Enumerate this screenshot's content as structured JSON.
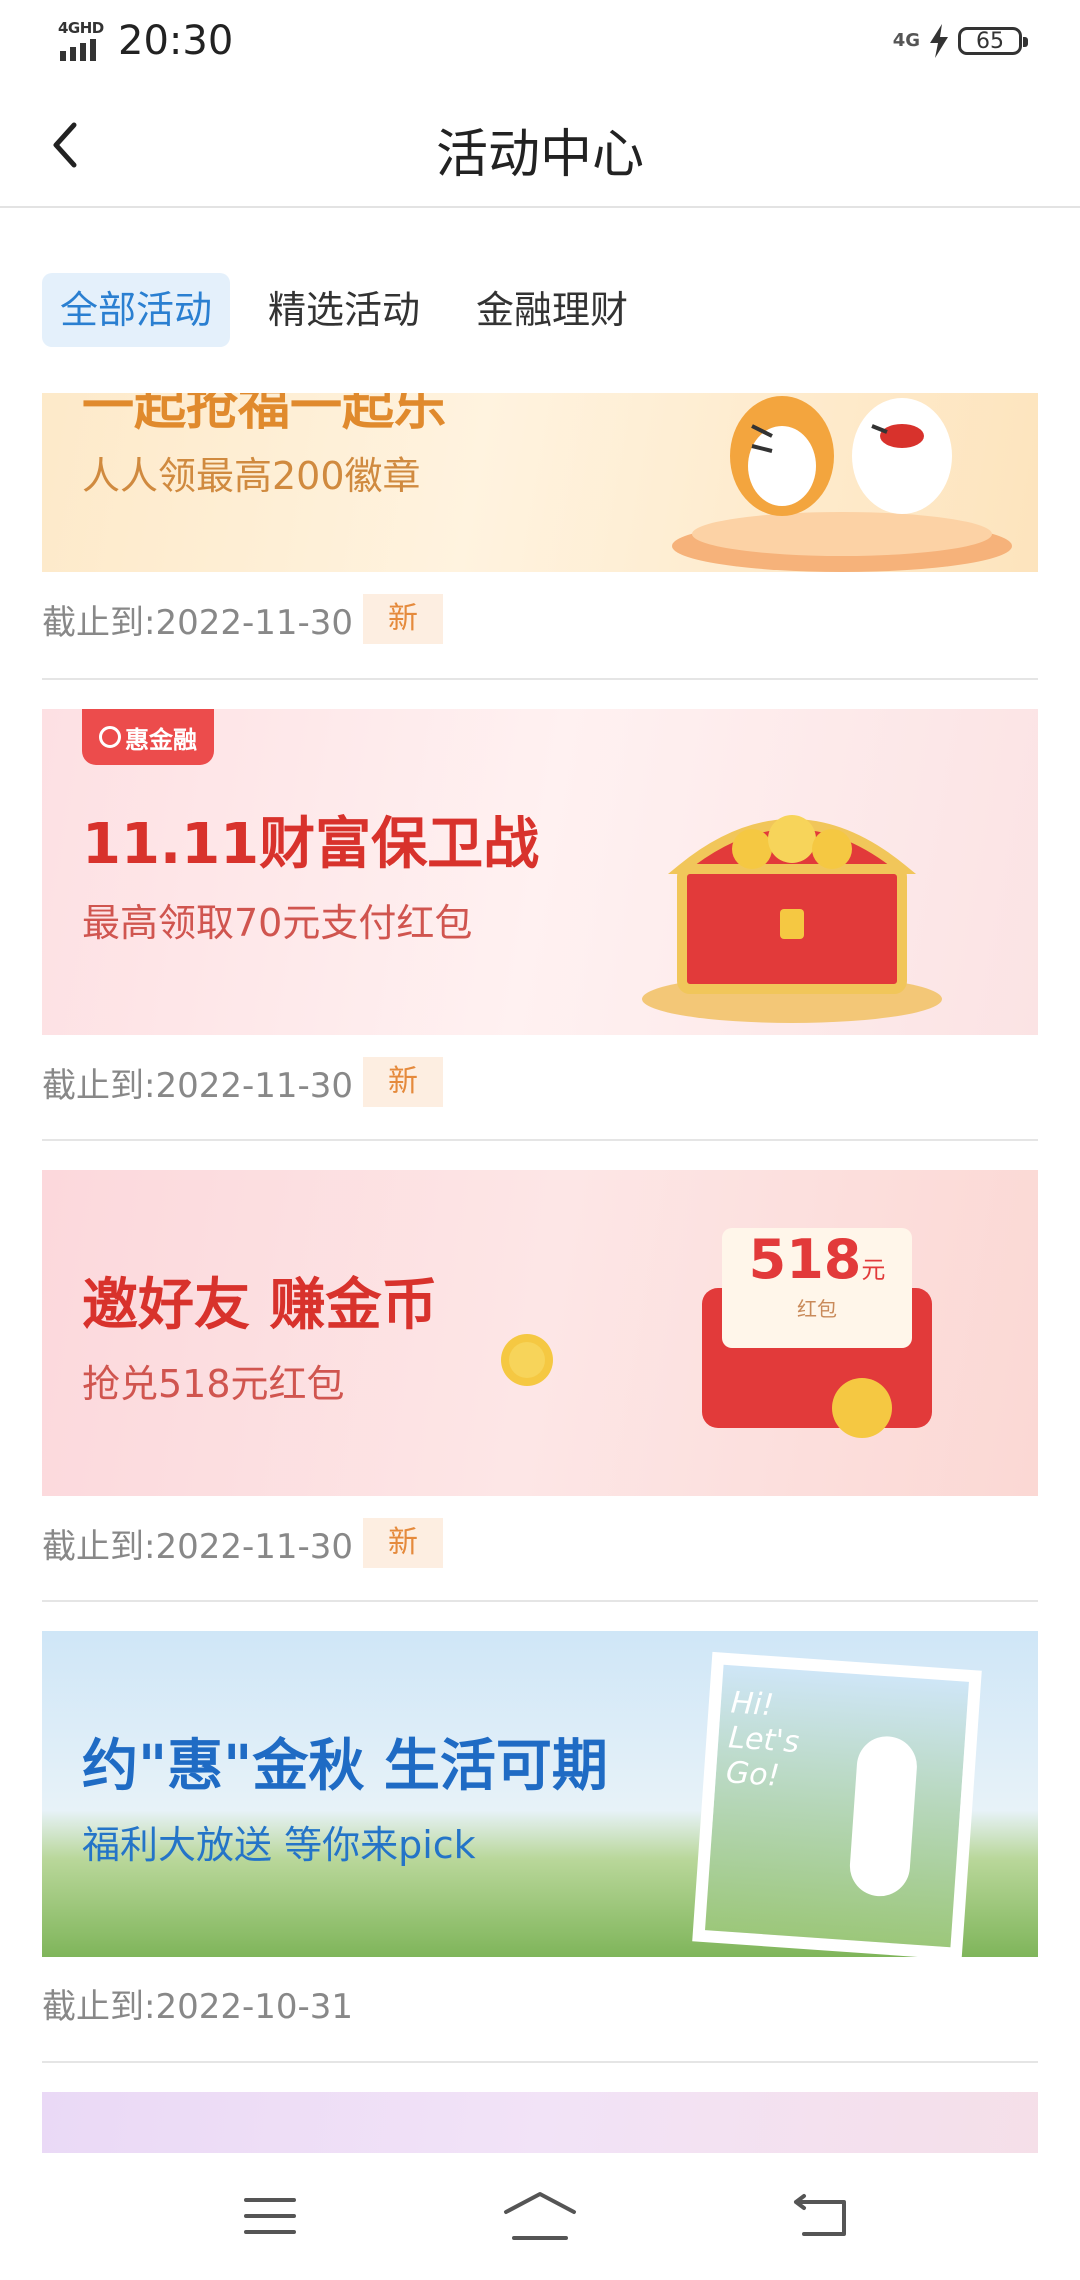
{
  "status_bar": {
    "network_label": "4GHD",
    "time": "20:30",
    "network_right": "4G",
    "battery": "65"
  },
  "header": {
    "title": "活动中心"
  },
  "tabs": [
    {
      "label": "全部活动",
      "active": true
    },
    {
      "label": "精选活动",
      "active": false
    },
    {
      "label": "金融理财",
      "active": false
    }
  ],
  "activities": [
    {
      "banner_title": "一起抢福一起乐",
      "banner_subtitle": "人人领最高200徽章",
      "deadline": "截止到:2022-11-30",
      "badge": "新"
    },
    {
      "brand": "惠金融",
      "banner_title": "11.11财富保卫战",
      "banner_subtitle": "最高领取70元支付红包",
      "deadline": "截止到:2022-11-30",
      "badge": "新"
    },
    {
      "banner_title": "邀好友 赚金币",
      "banner_subtitle": "抢兑518元红包",
      "envelope_amount": "518",
      "envelope_unit": "元",
      "envelope_label": "红包",
      "deadline": "截止到:2022-11-30",
      "badge": "新"
    },
    {
      "banner_title": "约\"惠\"金秋 生活可期",
      "banner_subtitle": "福利大放送 等你来pick",
      "photo_text": "Hi! Let's Go!",
      "deadline": "截止到:2022-10-31"
    }
  ],
  "colors": {
    "accent": "#2a7fd1",
    "badge_text": "#e58a3c",
    "banner_red": "#d8322c",
    "banner_blue": "#1f6bc4"
  }
}
